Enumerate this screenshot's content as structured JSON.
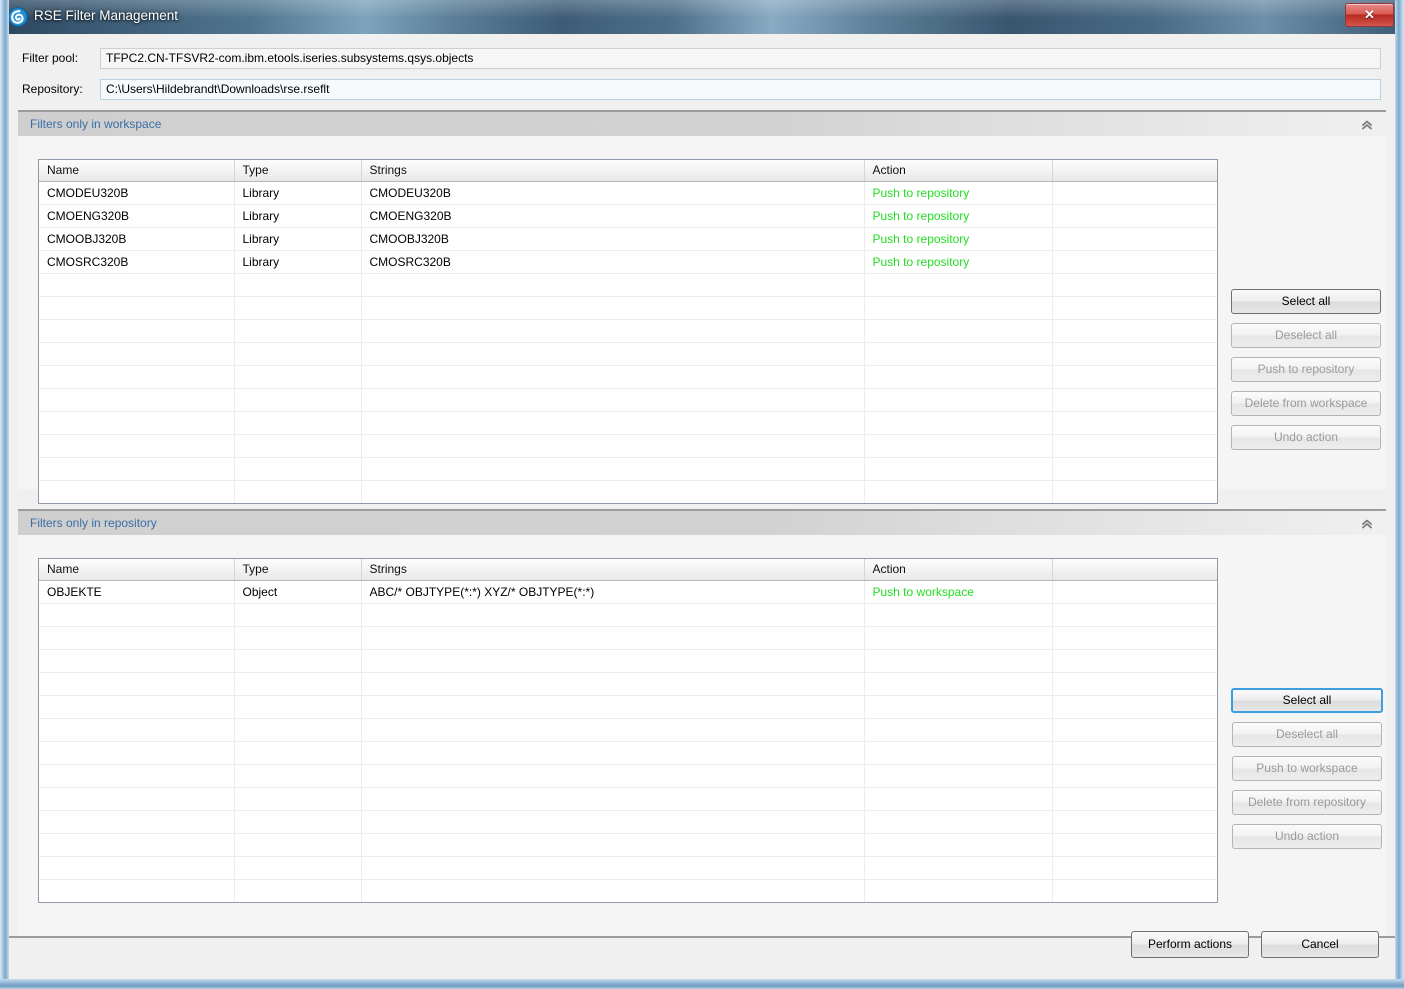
{
  "window": {
    "title": "RSE Filter Management",
    "icon": "rse-app-icon",
    "close_label": "✕"
  },
  "header": {
    "filter_pool_label": "Filter pool:",
    "filter_pool_value": "TFPC2.CN-TFSVR2-com.ibm.etools.iseries.subsystems.qsys.objects",
    "repository_label": "Repository:",
    "repository_value": "C:\\Users\\Hildebrandt\\Downloads\\rse.rseflt"
  },
  "colors": {
    "action_green": "#22dd22",
    "section_title_blue": "#3a6ea5",
    "focus_blue": "#3c9ede"
  },
  "workspace_section": {
    "title": "Filters only in workspace",
    "toggle_icon": "chevron-up-icon",
    "columns": [
      "Name",
      "Type",
      "Strings",
      "Action",
      ""
    ],
    "rows": [
      {
        "name": "CMODEU320B",
        "type": "Library",
        "strings": "CMODEU320B",
        "action": "Push to repository",
        "extra": ""
      },
      {
        "name": "CMOENG320B",
        "type": "Library",
        "strings": "CMOENG320B",
        "action": "Push to repository",
        "extra": ""
      },
      {
        "name": "CMOOBJ320B",
        "type": "Library",
        "strings": "CMOOBJ320B",
        "action": "Push to repository",
        "extra": ""
      },
      {
        "name": "CMOSRC320B",
        "type": "Library",
        "strings": "CMOSRC320B",
        "action": "Push to repository",
        "extra": ""
      }
    ],
    "empty_row_count": 11,
    "buttons": [
      {
        "label": "Select all",
        "enabled": true,
        "focused": false
      },
      {
        "label": "Deselect all",
        "enabled": false,
        "focused": false
      },
      {
        "label": "Push to repository",
        "enabled": false,
        "focused": false
      },
      {
        "label": "Delete from workspace",
        "enabled": false,
        "focused": false
      },
      {
        "label": "Undo action",
        "enabled": false,
        "focused": false
      }
    ]
  },
  "repository_section": {
    "title": "Filters only in repository",
    "toggle_icon": "chevron-up-icon",
    "columns": [
      "Name",
      "Type",
      "Strings",
      "Action",
      ""
    ],
    "rows": [
      {
        "name": "OBJEKTE",
        "type": "Object",
        "strings": "ABC/* OBJTYPE(*:*)     XYZ/* OBJTYPE(*:*)",
        "action": "Push to workspace",
        "extra": ""
      }
    ],
    "empty_row_count": 13,
    "buttons": [
      {
        "label": "Select all",
        "enabled": true,
        "focused": true
      },
      {
        "label": "Deselect all",
        "enabled": false,
        "focused": false
      },
      {
        "label": "Push to workspace",
        "enabled": false,
        "focused": false
      },
      {
        "label": "Delete from repository",
        "enabled": false,
        "focused": false
      },
      {
        "label": "Undo action",
        "enabled": false,
        "focused": false
      }
    ]
  },
  "footer": {
    "perform_label": "Perform actions",
    "cancel_label": "Cancel"
  }
}
